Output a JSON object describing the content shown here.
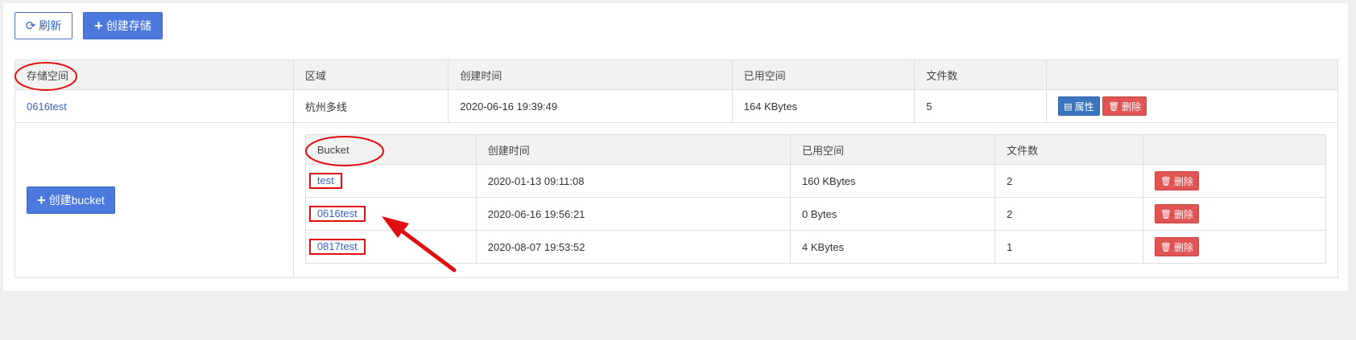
{
  "toolbar": {
    "refresh_label": "刷新",
    "create_storage_label": "创建存储"
  },
  "storage_table": {
    "headers": [
      "存储空间",
      "区域",
      "创建时间",
      "已用空间",
      "文件数",
      ""
    ],
    "rows": [
      {
        "name": "0616test",
        "region": "杭州多线",
        "created": "2020-06-16 19:39:49",
        "used": "164 KBytes",
        "files": "5",
        "props_label": "属性",
        "delete_label": "删除"
      }
    ]
  },
  "create_bucket_label": "创建bucket",
  "bucket_table": {
    "headers": [
      "Bucket",
      "创建时间",
      "已用空间",
      "文件数",
      ""
    ],
    "rows": [
      {
        "name": "test",
        "created": "2020-01-13 09:11:08",
        "used": "160 KBytes",
        "files": "2",
        "delete_label": "删除"
      },
      {
        "name": "0616test",
        "created": "2020-06-16 19:56:21",
        "used": "0 Bytes",
        "files": "2",
        "delete_label": "删除"
      },
      {
        "name": "0817test",
        "created": "2020-08-07 19:53:52",
        "used": "4 KBytes",
        "files": "1",
        "delete_label": "删除"
      }
    ]
  },
  "colors": {
    "primary": "#4c79dd",
    "link": "#3a62c9",
    "danger": "#e05454",
    "info": "#3b75c2",
    "annotation": "#e01010"
  },
  "icons": {
    "refresh": "refresh-icon",
    "plus": "plus-icon",
    "list": "list-icon",
    "trash": "trash-icon"
  }
}
